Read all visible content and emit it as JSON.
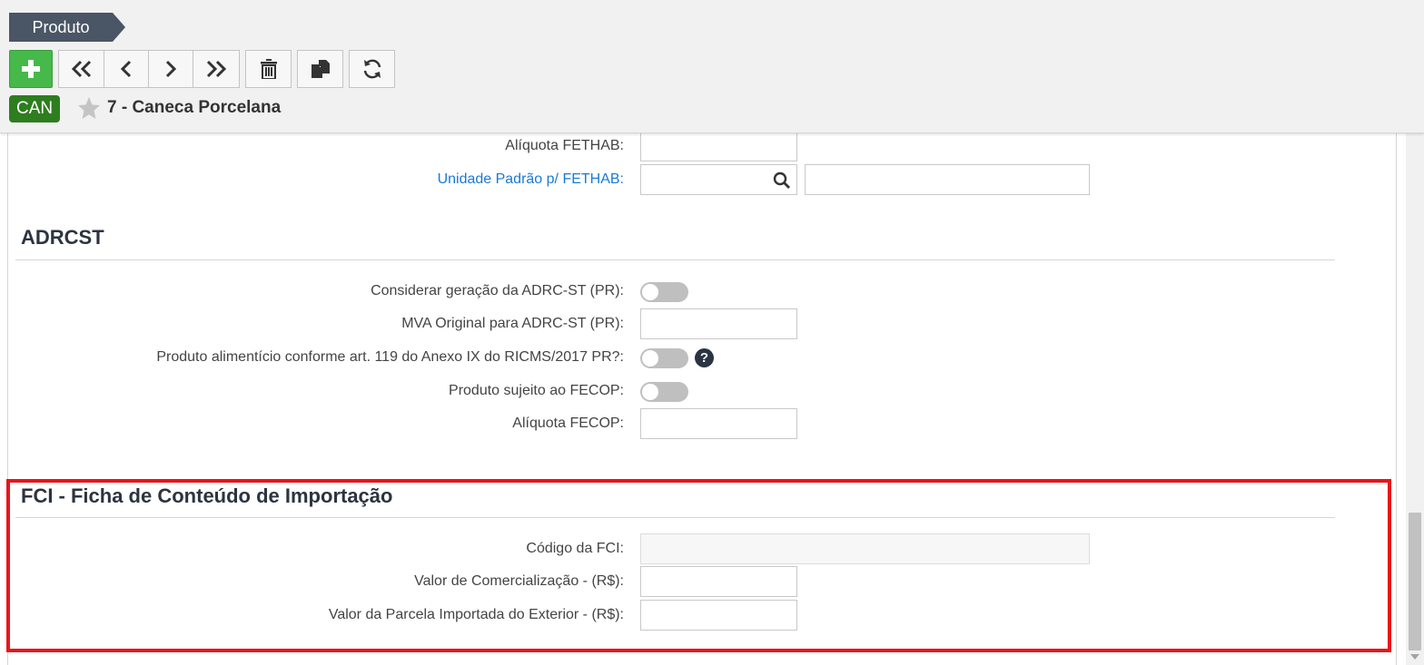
{
  "breadcrumb": {
    "label": "Produto"
  },
  "toolbar": {
    "buttons": [
      {
        "name": "add-button",
        "icon": "plus-icon"
      },
      {
        "name": "first-record-button",
        "icon": "double-chevron-left-icon"
      },
      {
        "name": "previous-record-button",
        "icon": "chevron-left-icon"
      },
      {
        "name": "next-record-button",
        "icon": "chevron-right-icon"
      },
      {
        "name": "last-record-button",
        "icon": "double-chevron-right-icon"
      },
      {
        "name": "delete-button",
        "icon": "trash-icon"
      },
      {
        "name": "copy-button",
        "icon": "copy-icon"
      },
      {
        "name": "refresh-button",
        "icon": "refresh-icon"
      }
    ]
  },
  "record": {
    "tag": "CAN",
    "title": "7 - Caneca Porcelana",
    "tag_color": "#2e7d1f"
  },
  "fethab": {
    "aliquota_label": "Alíquota FETHAB:",
    "aliquota_value": "",
    "unidade_label": "Unidade Padrão p/ FETHAB:",
    "unidade_value": "",
    "unidade_desc": ""
  },
  "adrcst": {
    "title": "ADRCST",
    "considerar_label": "Considerar geração da ADRC-ST (PR):",
    "considerar_on": false,
    "mva_label": "MVA Original para ADRC-ST (PR):",
    "mva_value": "",
    "alimenticio_label": "Produto alimentício conforme art. 119 do Anexo IX do RICMS/2017 PR?:",
    "alimenticio_on": false,
    "help_glyph": "?",
    "fecop_label": "Produto sujeito ao FECOP:",
    "fecop_on": false,
    "aliquota_fecop_label": "Alíquota FECOP:",
    "aliquota_fecop_value": ""
  },
  "fci": {
    "title": "FCI - Ficha de Conteúdo de Importação",
    "codigo_label": "Código da FCI:",
    "codigo_value": "",
    "valor_comercializacao_label": "Valor de Comercialização - (R$):",
    "valor_comercializacao_value": "",
    "valor_parcela_label": "Valor da Parcela Importada do Exterior - (R$):",
    "valor_parcela_value": ""
  },
  "colors": {
    "accent_green": "#46b94a",
    "link_blue": "#1a7ad4",
    "highlight_red": "#e8151b",
    "breadcrumb_bg": "#4a5566"
  }
}
